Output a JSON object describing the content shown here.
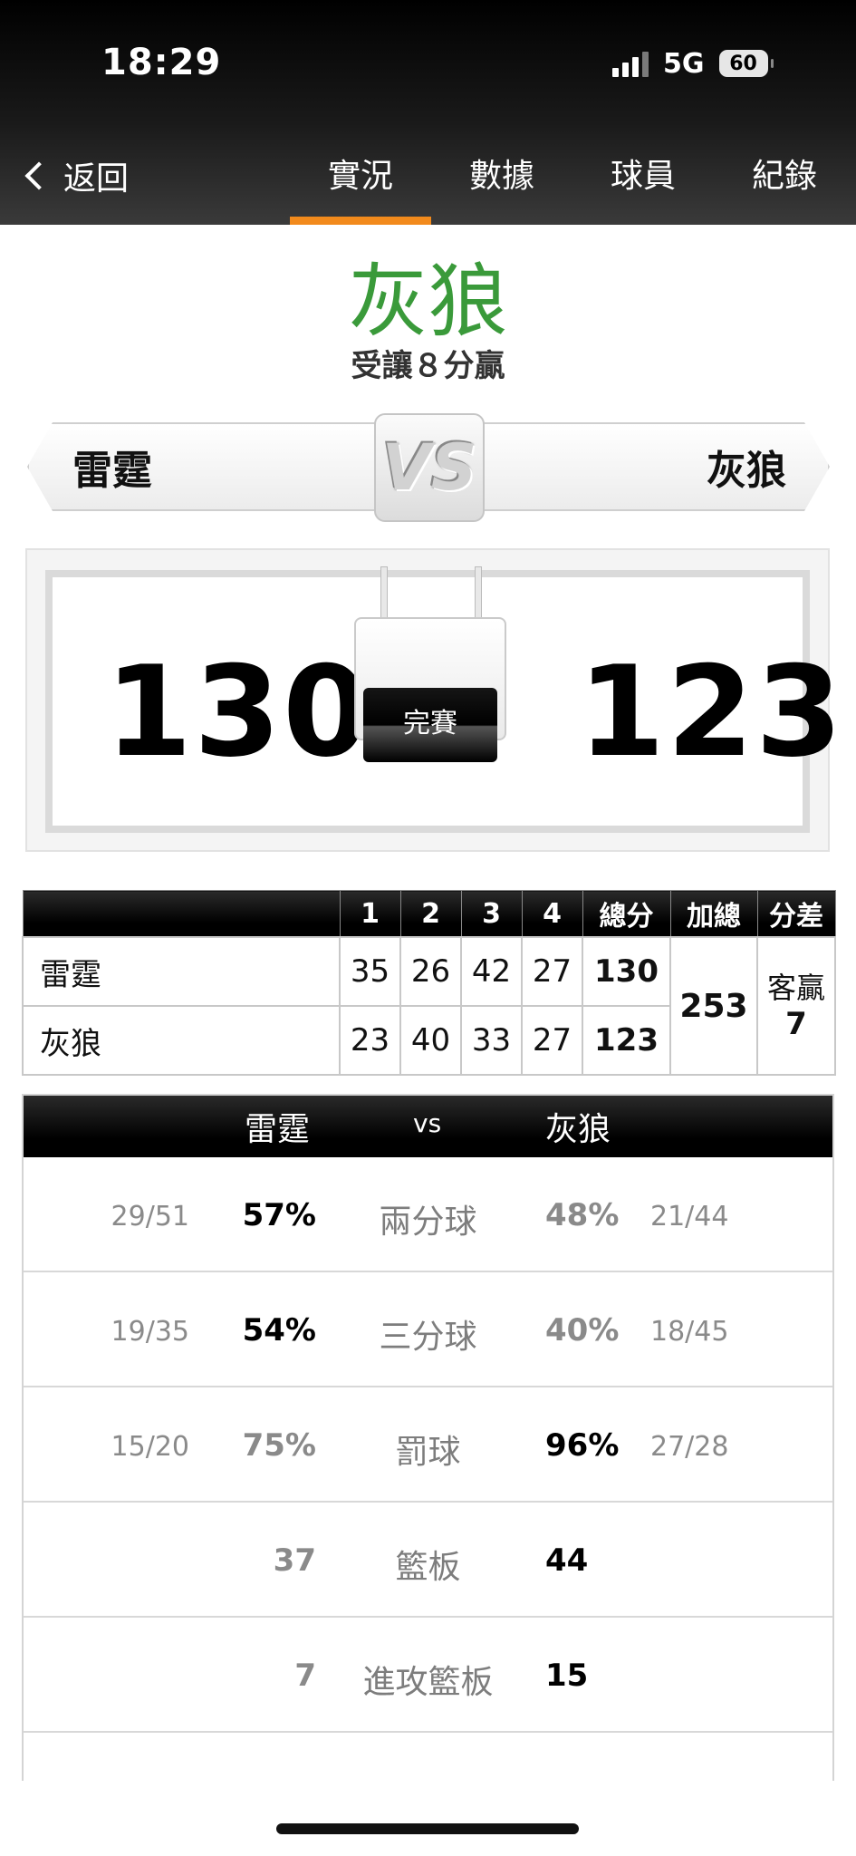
{
  "status_bar": {
    "time": "18:29",
    "network": "5G",
    "battery": "60"
  },
  "nav": {
    "back_label": "返回",
    "tabs": [
      {
        "label": "實況",
        "active": true
      },
      {
        "label": "數據",
        "active": false
      },
      {
        "label": "球員",
        "active": false
      },
      {
        "label": "紀錄",
        "active": false
      }
    ]
  },
  "result": {
    "winner": "灰狼",
    "spread_text": "受讓８分贏",
    "winner_color": "#3a9a3a"
  },
  "matchup": {
    "home": "雷霆",
    "away": "灰狼",
    "vs": "VS"
  },
  "scoreboard": {
    "home_score": "130",
    "away_score": "123",
    "status": "完賽"
  },
  "quarter_table": {
    "headers": [
      "",
      "1",
      "2",
      "3",
      "4",
      "總分",
      "加總",
      "分差"
    ],
    "rows": [
      {
        "team": "雷霆",
        "q": [
          "35",
          "26",
          "42",
          "27"
        ],
        "total": "130"
      },
      {
        "team": "灰狼",
        "q": [
          "23",
          "40",
          "33",
          "27"
        ],
        "total": "123"
      }
    ],
    "combined": "253",
    "diff_label": "客贏",
    "diff_value": "7"
  },
  "stats": {
    "home": "雷霆",
    "vs": "vs",
    "away": "灰狼",
    "rows": [
      {
        "name": "兩分球",
        "home_frac": "29/51",
        "home_val": "57%",
        "away_val": "48%",
        "away_frac": "21/44"
      },
      {
        "name": "三分球",
        "home_frac": "19/35",
        "home_val": "54%",
        "away_val": "40%",
        "away_frac": "18/45"
      },
      {
        "name": "罰球",
        "home_frac": "15/20",
        "home_val": "75%",
        "away_val": "96%",
        "away_frac": "27/28"
      },
      {
        "name": "籃板",
        "home_frac": "",
        "home_val": "37",
        "away_val": "44",
        "away_frac": ""
      },
      {
        "name": "進攻籃板",
        "home_frac": "",
        "home_val": "7",
        "away_val": "15",
        "away_frac": ""
      }
    ]
  },
  "accent_color": "#f28a1c"
}
